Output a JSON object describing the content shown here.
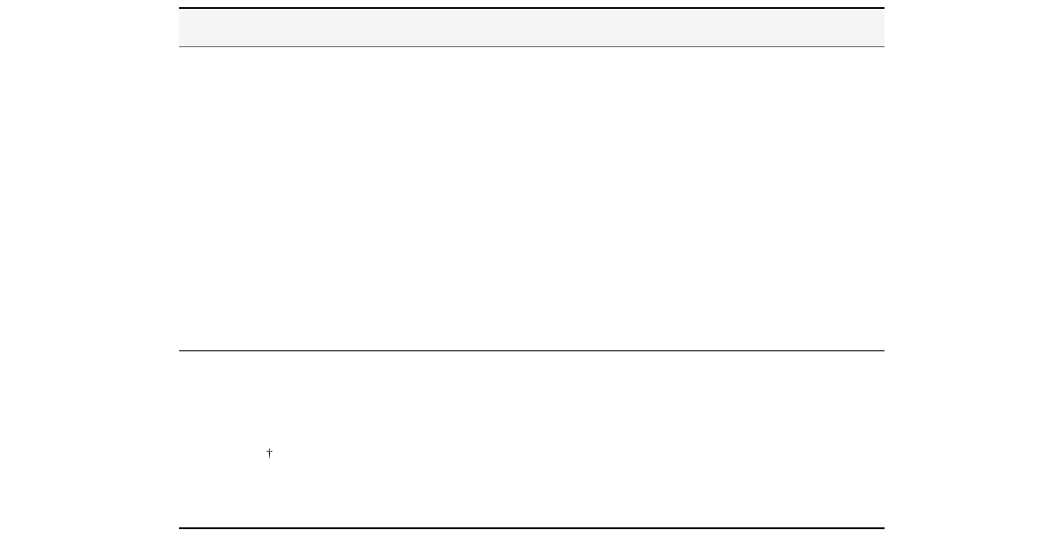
{
  "marks": {
    "dagger": "†"
  }
}
